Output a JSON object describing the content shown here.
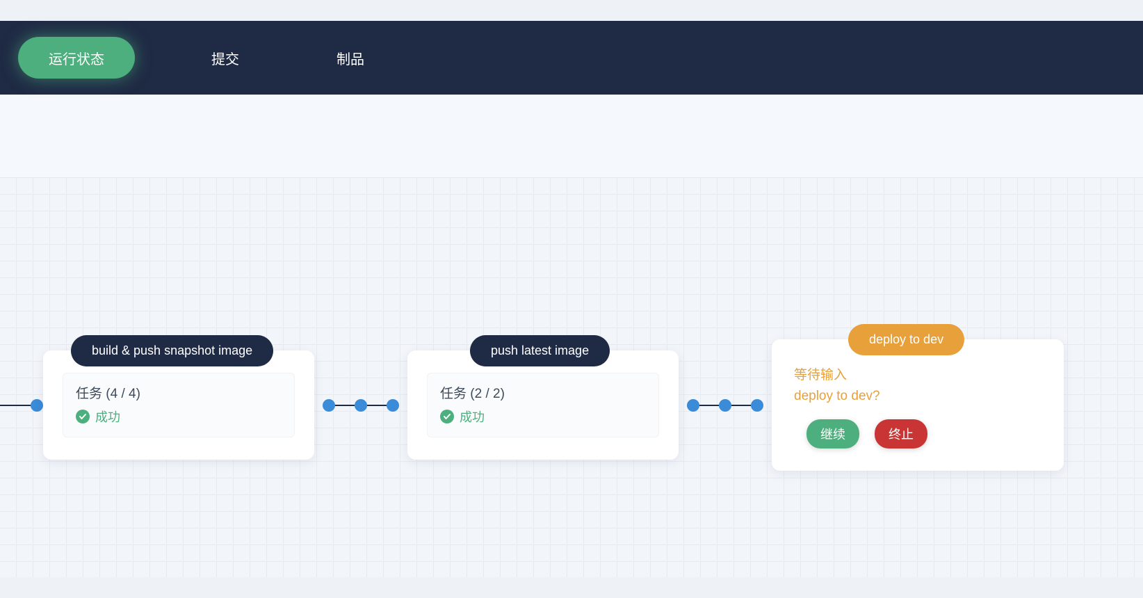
{
  "tabs": {
    "status": "运行状态",
    "commit": "提交",
    "artifact": "制品"
  },
  "stages": [
    {
      "label": "build & push snapshot image",
      "task_title": "任务 (4 / 4)",
      "status_text": "成功",
      "type": "success"
    },
    {
      "label": "push latest image",
      "task_title": "任务 (2 / 2)",
      "status_text": "成功",
      "type": "success"
    },
    {
      "label": "deploy to dev",
      "waiting_label": "等待输入",
      "prompt": "deploy to dev?",
      "continue_btn": "继续",
      "abort_btn": "终止",
      "type": "input"
    }
  ],
  "colors": {
    "header_bg": "#1f2a44",
    "active_tab": "#4caf7d",
    "success": "#4caf7d",
    "pending": "#e8a13a",
    "abort": "#c93434",
    "dot": "#3a8bd8"
  }
}
